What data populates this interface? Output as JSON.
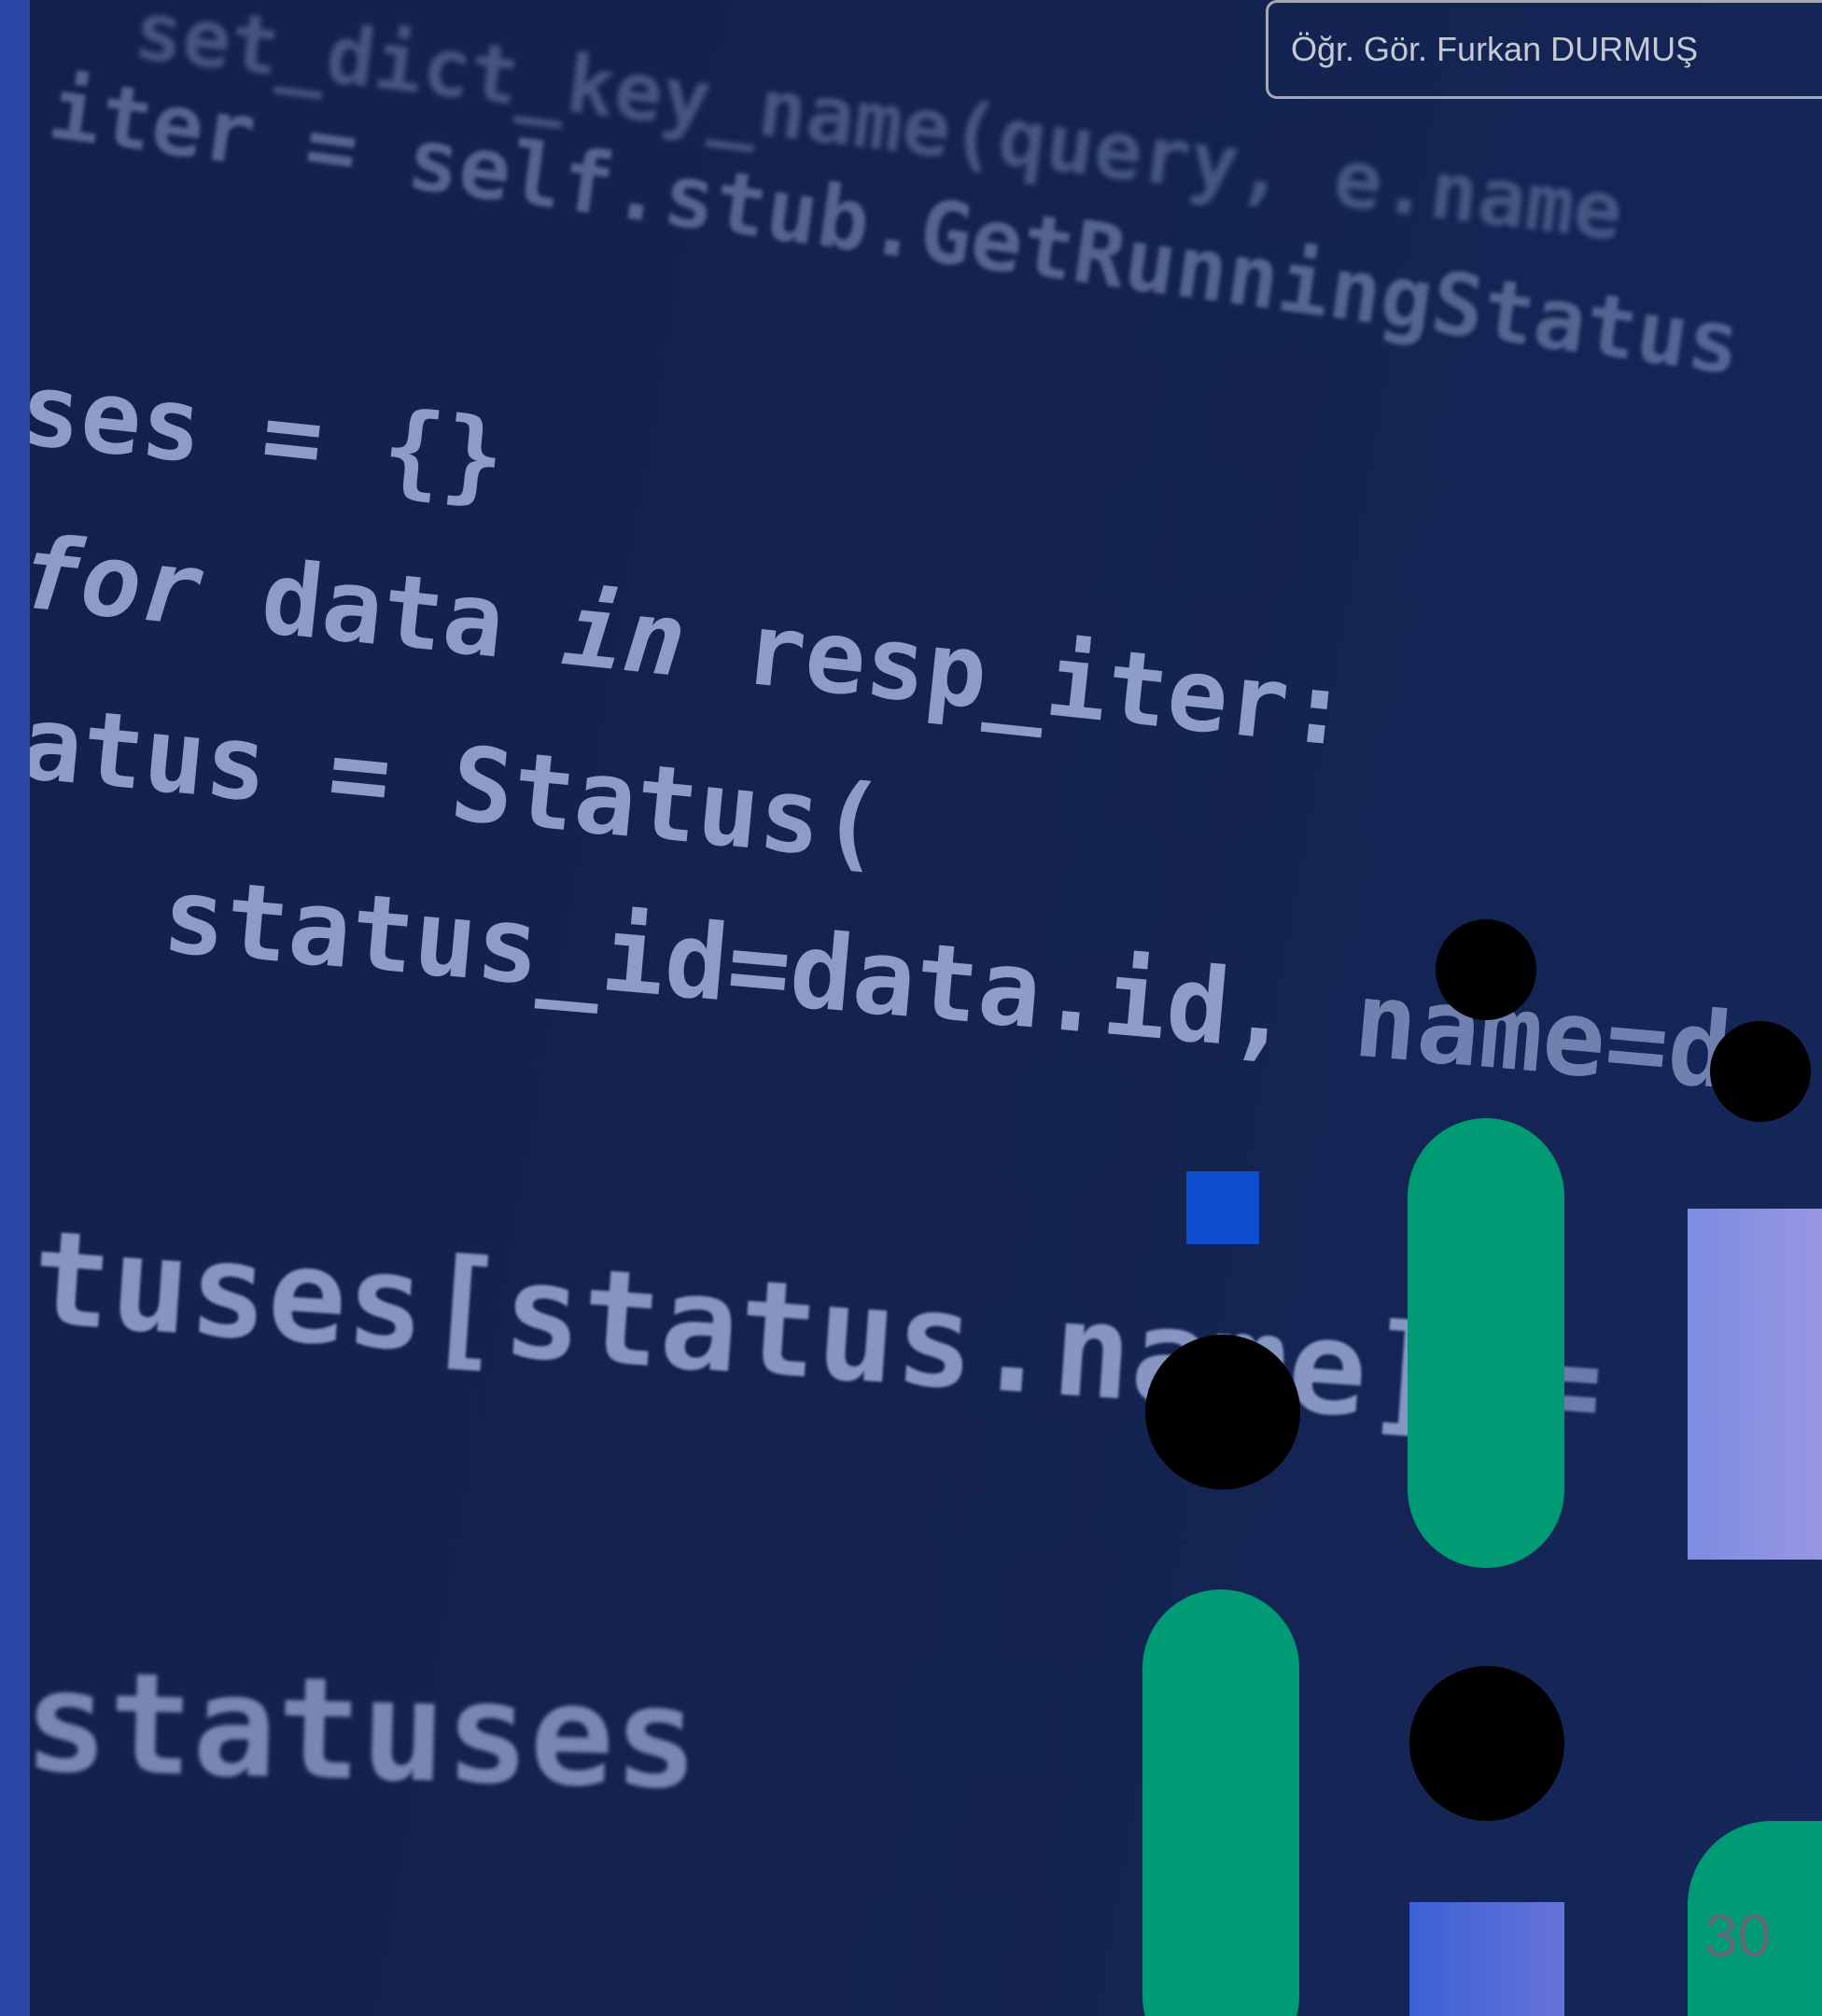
{
  "header": {
    "author": "Öğr. Gör. Furkan DURMUŞ"
  },
  "code_lines": {
    "l1": "set_dict_key_name(query, e.name",
    "l2": "iter = self.stub.GetRunningStatus",
    "l3": "ses = {}",
    "l4_kw": "for",
    "l4_rest": " data ",
    "l4_kw2": "in",
    "l4_end": " resp_iter:",
    "l5": "atus = Status(",
    "l6a": "status_id=data.id, ",
    "l6b": "name=d",
    "l7a": "tuses[status.name] ",
    "l7b": "= sta",
    "l8": "statuses"
  },
  "footer": {
    "page_number": "30"
  },
  "colors": {
    "background": "#13224e",
    "accent_stripe": "#2a47a6",
    "code_text": "#a3b2dd",
    "green": "#009a74",
    "blue_square": "#0d4ed1",
    "lavender": "#8e92e2",
    "black_dot": "#000000"
  }
}
